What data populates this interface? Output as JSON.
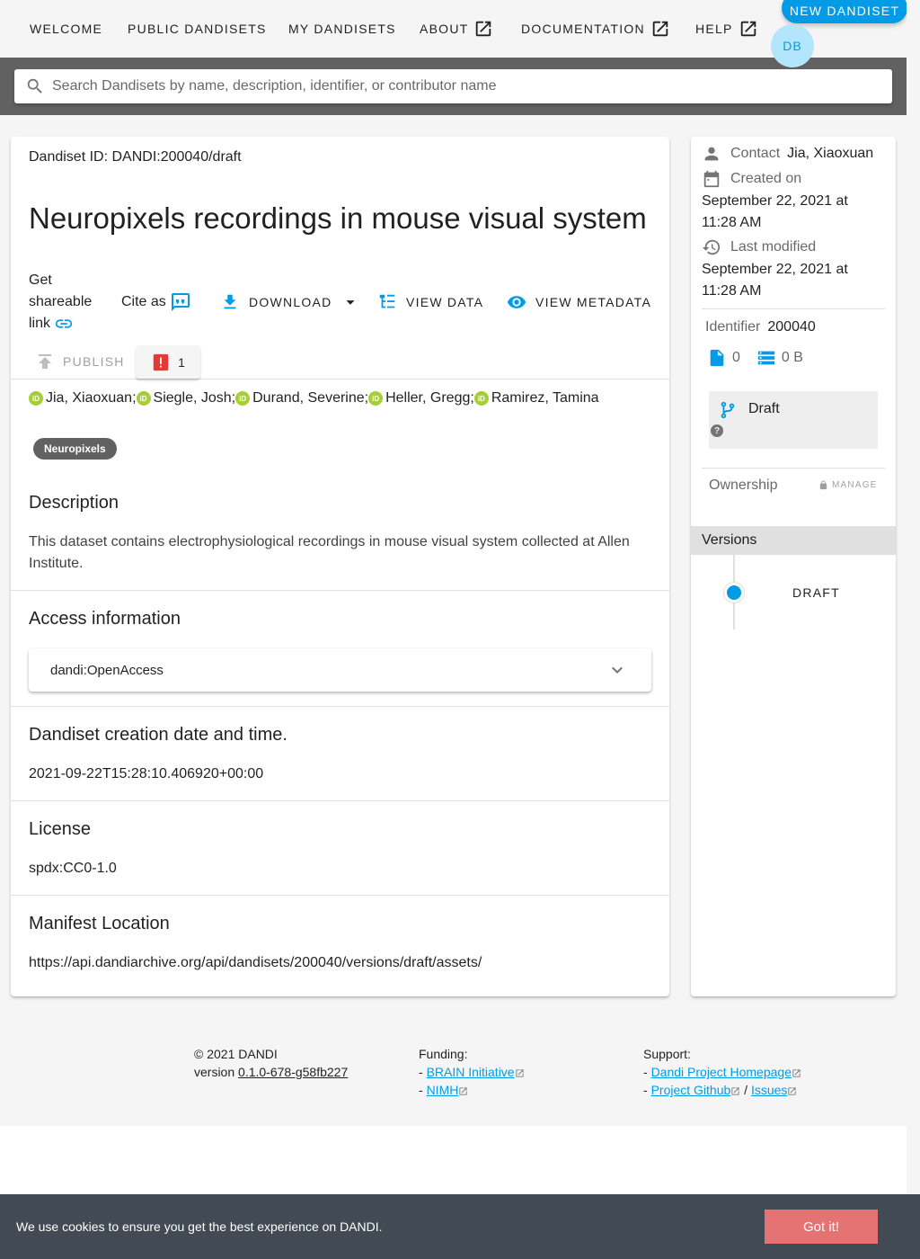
{
  "nav": {
    "items": [
      {
        "label": "WELCOME"
      },
      {
        "label": "PUBLIC DANDISETS"
      },
      {
        "label": "MY DANDISETS"
      },
      {
        "label": "ABOUT"
      },
      {
        "label": "DOCUMENTATION"
      },
      {
        "label": "HELP"
      }
    ],
    "new_dandiset": "NEW DANDISET",
    "avatar": "DB"
  },
  "search": {
    "placeholder": "Search Dandisets by name, description, identifier, or contributor name"
  },
  "dandiset": {
    "id_line": "Dandiset ID: DANDI:200040/draft",
    "title": "Neuropixels recordings in mouse visual system",
    "share_label": "Get shareable link",
    "cite_label": "Cite as",
    "download_label": "DOWNLOAD",
    "view_data_label": "VIEW DATA",
    "view_metadata_label": "VIEW METADATA",
    "publish_label": "PUBLISH",
    "error_count": "1",
    "contributors": [
      "Jia, Xiaoxuan;",
      "Siegle, Josh;",
      "Durand, Severine;",
      "Heller, Gregg;",
      "Ramirez, Tamina"
    ],
    "keyword": "Neuropixels",
    "description_heading": "Description",
    "description": "This dataset contains electrophysiological recordings in mouse visual system collected at Allen Institute.",
    "access_heading": "Access information",
    "access_value": "dandi:OpenAccess",
    "creation_heading": "Dandiset creation date and time.",
    "creation_value": "2021-09-22T15:28:10.406920+00:00",
    "license_heading": "License",
    "license_value": "spdx:CC0-1.0",
    "manifest_heading": "Manifest Location",
    "manifest_value": "https://api.dandiarchive.org/api/dandisets/200040/versions/draft/assets/"
  },
  "side": {
    "contact_label": "Contact",
    "contact_value": "Jia, Xiaoxuan",
    "created_label": "Created on",
    "created_value": "September 22, 2021 at 11:28 AM",
    "modified_label": "Last modified",
    "modified_value": "September 22, 2021 at 11:28 AM",
    "identifier_label": "Identifier",
    "identifier_value": "200040",
    "file_count": "0",
    "size": "0 B",
    "draft_label": "Draft",
    "help_glyph": "?",
    "ownership_label": "Ownership",
    "manage_label": "MANAGE",
    "versions_label": "Versions",
    "version_item": "DRAFT"
  },
  "footer": {
    "copyright": "© 2021 DANDI",
    "version_prefix": "version ",
    "version": "0.1.0-678-g58fb227",
    "funding_label": "Funding:",
    "funding_links": [
      "BRAIN Initiative",
      "NIMH"
    ],
    "support_label": "Support:",
    "support_links": [
      "Dandi Project Homepage",
      "Project Github",
      "Issues"
    ],
    "dash": "- ",
    "slash": " / "
  },
  "cookie": {
    "message": "We use cookies to ensure you get the best experience on DANDI.",
    "button": "Got it!"
  },
  "colors": {
    "accent": "#039be5",
    "header_band": "#616161",
    "cookie_bg": "#424a53",
    "cookie_button": "#e57373",
    "orcid": "#a6ce39",
    "error": "#e53935"
  }
}
